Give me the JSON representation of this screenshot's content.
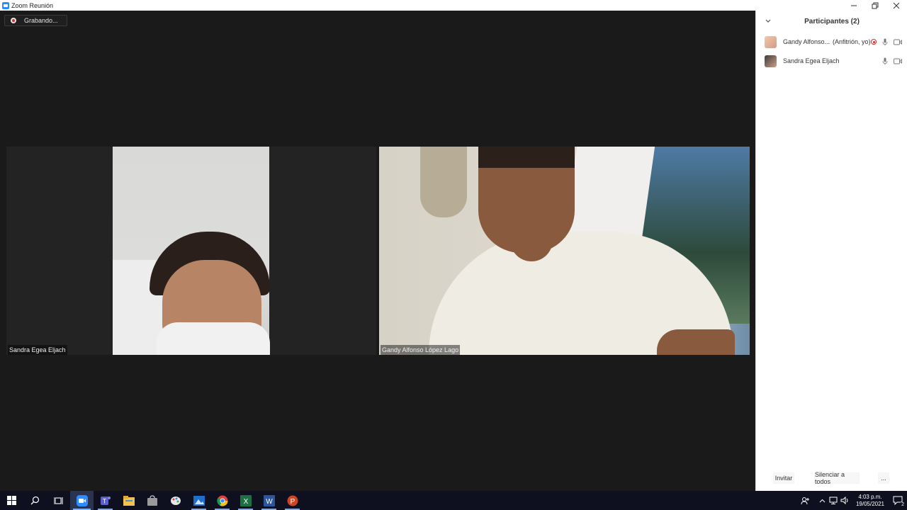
{
  "window": {
    "title": "Zoom Reunión",
    "controls": {
      "minimize": "—",
      "restore": "❐",
      "close": "✕"
    }
  },
  "meeting": {
    "recording_label": "Grabando...",
    "tiles": [
      {
        "name": "Sandra Egea Eljach"
      },
      {
        "name": "Gandy Alfonso López Lago"
      }
    ]
  },
  "participants": {
    "title": "Participantes (2)",
    "list": [
      {
        "name": "Gandy Alfonso...",
        "role": "(Anfitrión, yo)",
        "recording": true
      },
      {
        "name": "Sandra Egea Eljach",
        "role": "",
        "recording": false
      }
    ],
    "footer": {
      "invite": "Invitar",
      "mute_all": "Silenciar a todos",
      "more": "..."
    }
  },
  "taskbar": {
    "apps": [
      "start-icon",
      "search-icon",
      "task-view-icon",
      "zoom-icon",
      "teams-icon",
      "file-explorer-icon",
      "store-icon",
      "paint-icon",
      "photos-icon",
      "chrome-icon",
      "excel-icon",
      "word-icon",
      "powerpoint-icon"
    ],
    "time": "4:03 p.m.",
    "date": "19/05/2021",
    "notifications_count": "2"
  },
  "colors": {
    "background": "#1a1a1a",
    "recording_red": "#e02828",
    "zoom_blue": "#2d8cff",
    "taskbar": "#0e0f1f"
  }
}
